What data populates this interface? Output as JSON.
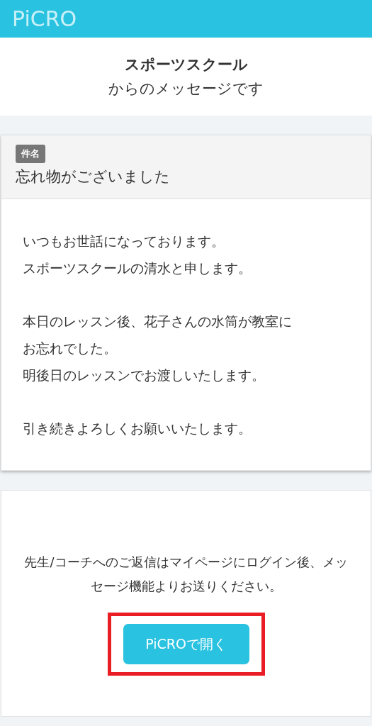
{
  "header": {
    "logo": "PiCRO"
  },
  "sender": {
    "name": "スポーツスクール",
    "suffix": "からのメッセージです"
  },
  "message": {
    "subject_label": "件名",
    "subject": "忘れ物がございました",
    "paragraphs": [
      [
        "いつもお世話になっております。",
        "スポーツスクールの清水と申します。"
      ],
      [
        "本日のレッスン後、花子さんの水筒が教室に",
        "お忘れでした。",
        "明後日のレッスンでお渡しいたします。"
      ],
      [
        "引き続きよろしくお願いいたします。"
      ]
    ]
  },
  "reply": {
    "note": "先生/コーチへのご返信はマイページにログイン後、メッセージ機能よりお送りください。",
    "button": {
      "label": "PiCROで開く",
      "highlighted": true
    }
  }
}
